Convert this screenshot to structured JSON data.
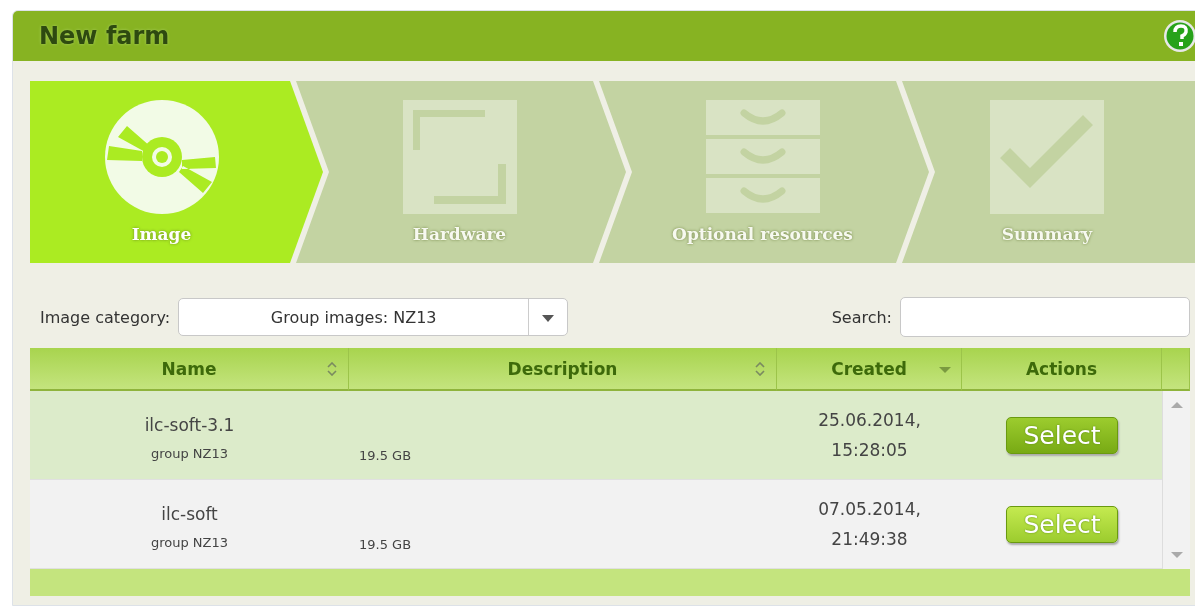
{
  "panel": {
    "title": "New farm"
  },
  "steps": [
    {
      "label": "Image",
      "kind": "disc",
      "selected": true
    },
    {
      "label": "Hardware",
      "kind": "frame",
      "selected": false
    },
    {
      "label": "Optional resources",
      "kind": "drawers",
      "selected": false
    },
    {
      "label": "Summary",
      "kind": "check",
      "selected": false
    }
  ],
  "filter": {
    "label": "Image category:",
    "value": "Group images: NZ13"
  },
  "search": {
    "label": "Search:"
  },
  "table": {
    "columns": [
      {
        "label": "Name",
        "sortable": true,
        "sorted": false
      },
      {
        "label": "Description",
        "sortable": true,
        "sorted": false
      },
      {
        "label": "Created",
        "sortable": true,
        "sorted": true
      },
      {
        "label": "Actions",
        "sortable": false,
        "sorted": false
      }
    ],
    "rows": [
      {
        "name": "ilc-soft-3.1",
        "group": "group NZ13",
        "size": "19.5 GB",
        "date": "25.06.2014,",
        "time": "15:28:05",
        "action": "Select",
        "selected": true
      },
      {
        "name": "ilc-soft",
        "group": "group NZ13",
        "size": "19.5 GB",
        "date": "07.05.2014,",
        "time": "21:49:38",
        "action": "Select",
        "selected": false
      }
    ]
  }
}
